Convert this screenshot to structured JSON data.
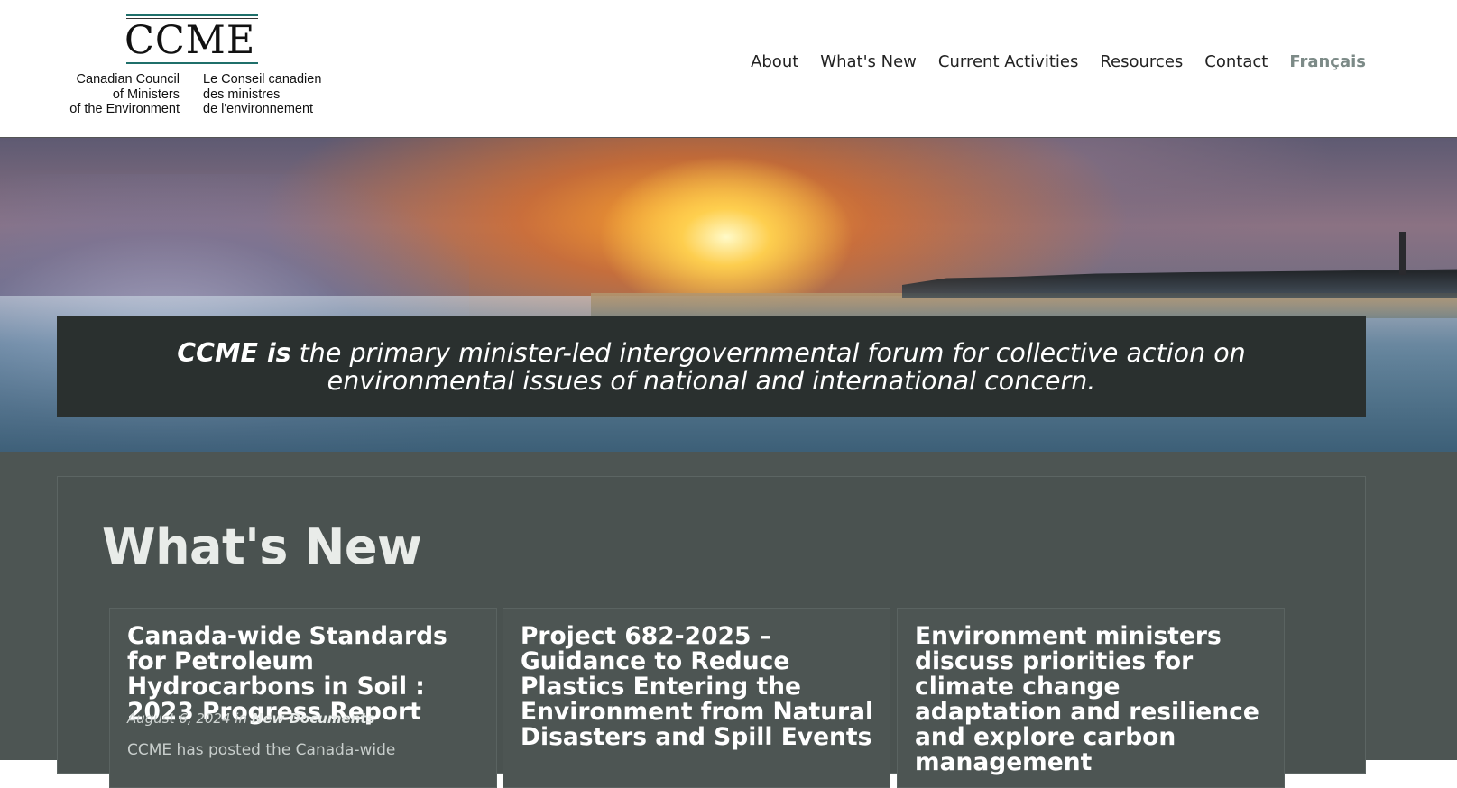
{
  "logo": {
    "wordmark": "CCME",
    "english_lines": [
      "Canadian Council",
      "of Ministers",
      "of the Environment"
    ],
    "french_lines": [
      "Le Conseil canadien",
      "des ministres",
      "de l'environnement"
    ]
  },
  "nav": {
    "items": [
      "About",
      "What's New",
      "Current Activities",
      "Resources",
      "Contact"
    ],
    "language": "Français"
  },
  "hero": {
    "lead": "CCME is",
    "text": " the primary minister-led intergovernmental forum for collective action on environmental issues of national and international concern."
  },
  "whats_new": {
    "title": "What's New",
    "cards": [
      {
        "title": "Canada-wide Standards for Petroleum Hydrocarbons in Soil : 2023 Progress Report",
        "date": "August 6, 2024",
        "in_word": "in",
        "category": "New Documents",
        "excerpt": "CCME has posted the Canada-wide"
      },
      {
        "title": "Project 682-2025 – Guidance to Reduce Plastics Entering the Environment from Natural Disasters and Spill Events"
      },
      {
        "title": "Environment ministers discuss priorities for climate change adaptation and resilience and explore carbon management"
      }
    ]
  },
  "colors": {
    "nav_language": "#7c8a87",
    "hero_banner": "#2a302f",
    "content_bg": "#4d5553",
    "logo_rule": "#1f6f6a"
  }
}
